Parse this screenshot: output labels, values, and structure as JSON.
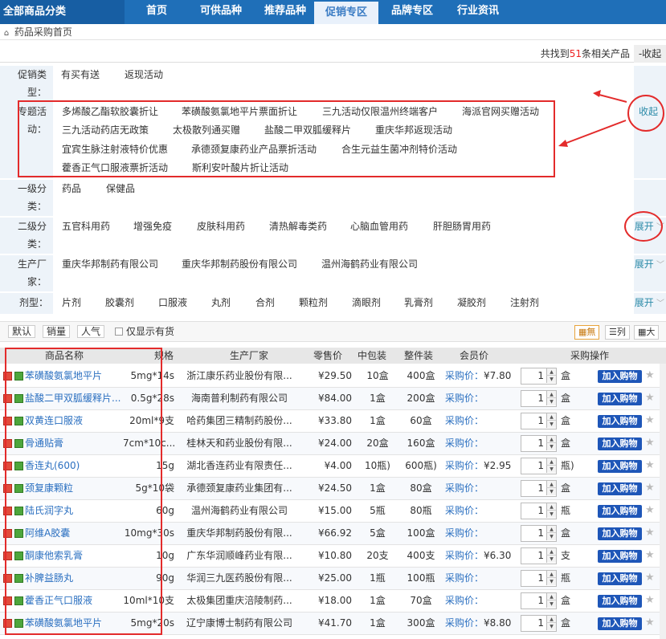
{
  "nav": {
    "all_categories": "全部商品分类",
    "items": [
      {
        "label": "首页"
      },
      {
        "label": "可供品种"
      },
      {
        "label": "推荐品种"
      },
      {
        "label": "促销专区"
      },
      {
        "label": "品牌专区"
      },
      {
        "label": "行业资讯"
      }
    ],
    "active_index": 3
  },
  "breadcrumb": {
    "label": "药品采购首页"
  },
  "result": {
    "prefix": "共找到",
    "count": "51",
    "suffix": "条相关产品",
    "collapse": "-收起"
  },
  "filters": {
    "promo_type": {
      "label": "促销类型：",
      "options": [
        "有买有送",
        "返现活动"
      ]
    },
    "topic": {
      "label": "专题活动：",
      "options": [
        "多烯酸乙酯软胶囊折让",
        "苯磺酸氨氯地平片票面折让",
        "三九活动仅限温州终端客户",
        "海派官网买赠活动",
        "三九活动药店无政策",
        "太极散列通买赠",
        "盐酸二甲双胍缓释片",
        "重庆华邦返现活动",
        "宜宾生脉注射液特价优惠",
        "承德颈复康药业产品票折活动",
        "合生元益生菌冲剂特价活动",
        "藿香正气口服液票折活动",
        "斯利安叶酸片折让活动"
      ],
      "toggle": "收起"
    },
    "level1": {
      "label": "一级分类：",
      "options": [
        "药品",
        "保健品"
      ]
    },
    "level2": {
      "label": "二级分类：",
      "options": [
        "五官科用药",
        "增强免疫",
        "皮肤科用药",
        "清热解毒类药",
        "心脑血管用药",
        "肝胆肠胃用药"
      ],
      "toggle": "展开"
    },
    "manufacturer": {
      "label": "生产厂家：",
      "options": [
        "重庆华邦制药有限公司",
        "重庆华邦制药股份有限公司",
        "温州海鹤药业有限公司"
      ],
      "toggle": "展开"
    },
    "dosage": {
      "label": "剂型：",
      "options": [
        "片剂",
        "胶囊剂",
        "口服液",
        "丸剂",
        "合剂",
        "颗粒剂",
        "滴眼剂",
        "乳膏剂",
        "凝胶剂",
        "注射剂"
      ],
      "toggle": "展开"
    }
  },
  "sortbar": {
    "default": "默认",
    "sales": "销量",
    "popularity": "人气",
    "in_stock_only": "仅显示有货",
    "view_none": "無",
    "view_list": "列",
    "view_large": "大"
  },
  "table": {
    "headers": {
      "name": "商品名称",
      "spec": "规格",
      "mfr": "生产厂家",
      "price": "零售价",
      "mid": "中包装",
      "pack": "整件装",
      "member": "会员价",
      "ops": "采购操作"
    },
    "add_label": "加入购物",
    "purchase_price_label": "采购价：",
    "rows": [
      {
        "name": "苯磺酸氨氯地平片",
        "spec": "5mg*14s",
        "mfr": "浙江康乐药业股份有限...",
        "price": "¥29.50",
        "mid": "10盒",
        "pack": "400盒",
        "member": "¥7.80",
        "qty": "1",
        "unit": "盒"
      },
      {
        "name": "盐酸二甲双胍缓释片...",
        "spec": "0.5g*28s",
        "mfr": "海南普利制药有限公司",
        "price": "¥84.00",
        "mid": "1盒",
        "pack": "200盒",
        "member": "",
        "qty": "1",
        "unit": "盒"
      },
      {
        "name": "双黄连口服液",
        "spec": "20ml*9支",
        "mfr": "哈药集团三精制药股份...",
        "price": "¥33.80",
        "mid": "1盒",
        "pack": "60盒",
        "member": "",
        "qty": "1",
        "unit": "盒"
      },
      {
        "name": "骨通贴膏",
        "spec": "7cm*10c...",
        "mfr": "桂林天和药业股份有限...",
        "price": "¥24.00",
        "mid": "20盒",
        "pack": "160盒",
        "member": "",
        "qty": "1",
        "unit": "盒"
      },
      {
        "name": "香连丸(600)",
        "spec": "15g",
        "mfr": "湖北香连药业有限责任...",
        "price": "¥4.00",
        "mid": "10瓶)",
        "pack": "600瓶)",
        "member": "¥2.95",
        "qty": "1",
        "unit": "瓶)"
      },
      {
        "name": "颈复康颗粒",
        "spec": "5g*10袋",
        "mfr": "承德颈复康药业集团有...",
        "price": "¥24.50",
        "mid": "1盒",
        "pack": "80盒",
        "member": "",
        "qty": "1",
        "unit": "盒"
      },
      {
        "name": "陆氏润字丸",
        "spec": "60g",
        "mfr": "温州海鹤药业有限公司",
        "price": "¥15.00",
        "mid": "5瓶",
        "pack": "80瓶",
        "member": "",
        "qty": "1",
        "unit": "瓶"
      },
      {
        "name": "阿维A胶囊",
        "spec": "10mg*30s",
        "mfr": "重庆华邦制药股份有限...",
        "price": "¥66.92",
        "mid": "5盒",
        "pack": "100盒",
        "member": "",
        "qty": "1",
        "unit": "盒"
      },
      {
        "name": "酮康他索乳膏",
        "spec": "10g",
        "mfr": "广东华润顺峰药业有限...",
        "price": "¥10.80",
        "mid": "20支",
        "pack": "400支",
        "member": "¥6.30",
        "qty": "1",
        "unit": "支"
      },
      {
        "name": "补脾益肠丸",
        "spec": "90g",
        "mfr": "华润三九医药股份有限...",
        "price": "¥25.00",
        "mid": "1瓶",
        "pack": "100瓶",
        "member": "",
        "qty": "1",
        "unit": "瓶"
      },
      {
        "name": "藿香正气口服液",
        "spec": "10ml*10支",
        "mfr": "太极集团重庆涪陵制药...",
        "price": "¥18.00",
        "mid": "1盒",
        "pack": "70盒",
        "member": "",
        "qty": "1",
        "unit": "盒"
      },
      {
        "name": "苯磺酸氨氯地平片",
        "spec": "5mg*20s",
        "mfr": "辽宁康博士制药有限公司",
        "price": "¥41.70",
        "mid": "1盒",
        "pack": "300盒",
        "member": "¥8.80",
        "qty": "1",
        "unit": "盒"
      }
    ]
  },
  "colors": {
    "nav_bg": "#1f6fb8",
    "link": "#2a6fc0",
    "highlight_red": "#e22",
    "annotation": "#e32b2b",
    "add_button": "#1e56b8"
  }
}
